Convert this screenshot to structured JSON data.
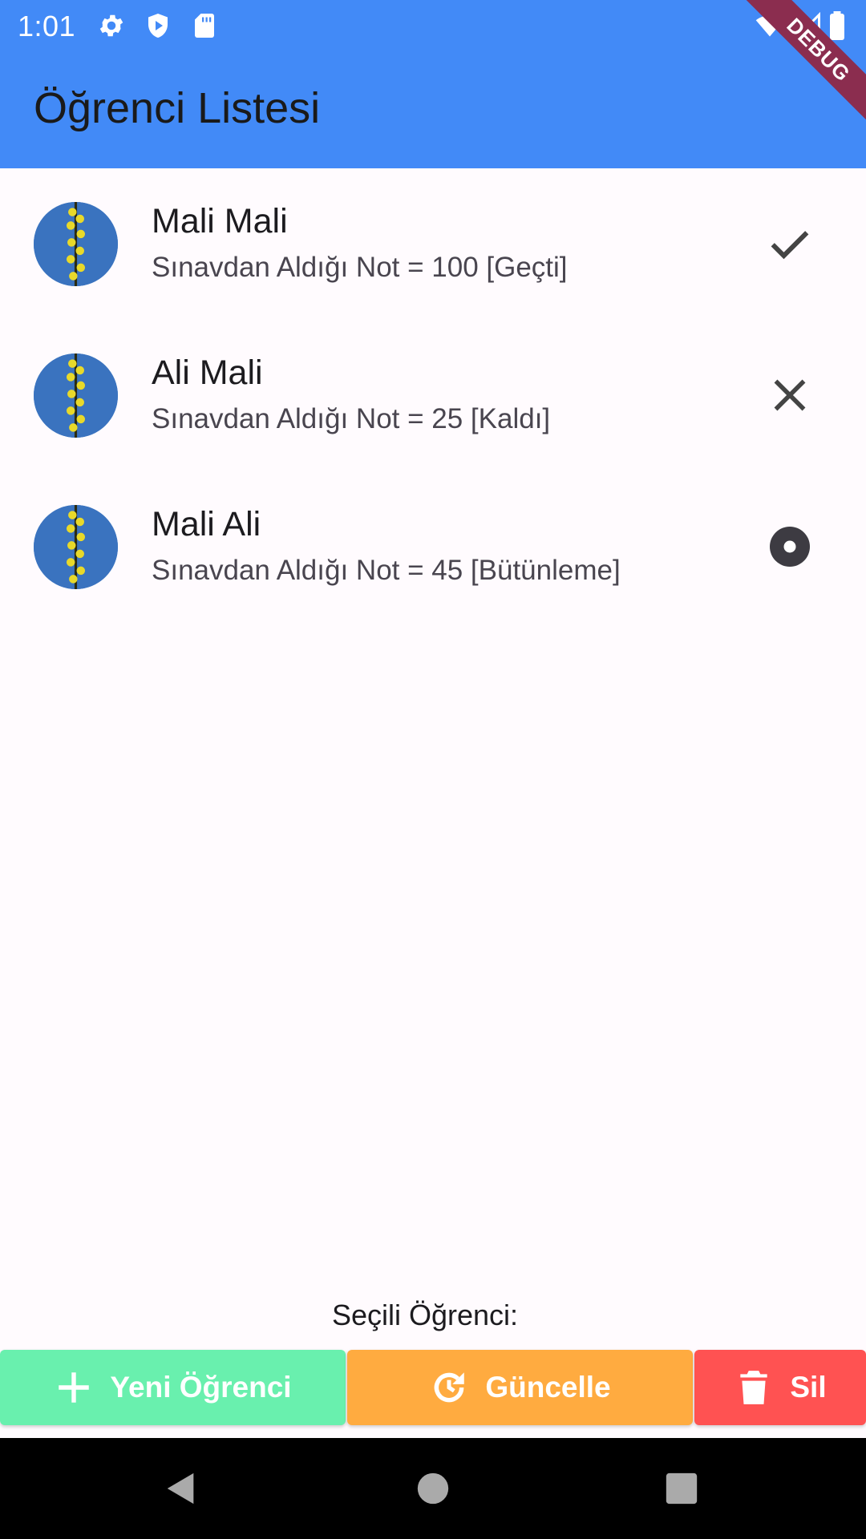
{
  "status_bar": {
    "time": "1:01",
    "left_icons": [
      "gear-icon",
      "shield-icon",
      "sd-card-icon"
    ],
    "right_icons": [
      "wifi-icon",
      "signal-icon",
      "battery-icon"
    ]
  },
  "app_bar": {
    "title": "Öğrenci Listesi",
    "debug_banner": "DEBUG",
    "color": "#428af7"
  },
  "students": [
    {
      "name": "Mali Mali",
      "subtitle": "Sınavdan Aldığı Not = 100 [Geçti]",
      "status_icon": "check-icon"
    },
    {
      "name": "Ali Mali",
      "subtitle": "Sınavdan Aldığı Not = 25 [Kaldı]",
      "status_icon": "close-icon"
    },
    {
      "name": "Mali Ali",
      "subtitle": "Sınavdan Aldığı Not = 45 [Bütünleme]",
      "status_icon": "radio-button-checked-icon"
    }
  ],
  "selected_student_label": "Seçili Öğrenci:",
  "actions": {
    "add": {
      "label": "Yeni Öğrenci",
      "icon": "plus-icon",
      "color": "#69f0ae"
    },
    "update": {
      "label": "Güncelle",
      "icon": "update-icon",
      "color": "#ffab40"
    },
    "delete": {
      "label": "Sil",
      "icon": "trash-icon",
      "color": "#ff5252"
    }
  },
  "nav_bar": {
    "buttons": [
      "back-icon",
      "home-icon",
      "recents-icon"
    ]
  }
}
